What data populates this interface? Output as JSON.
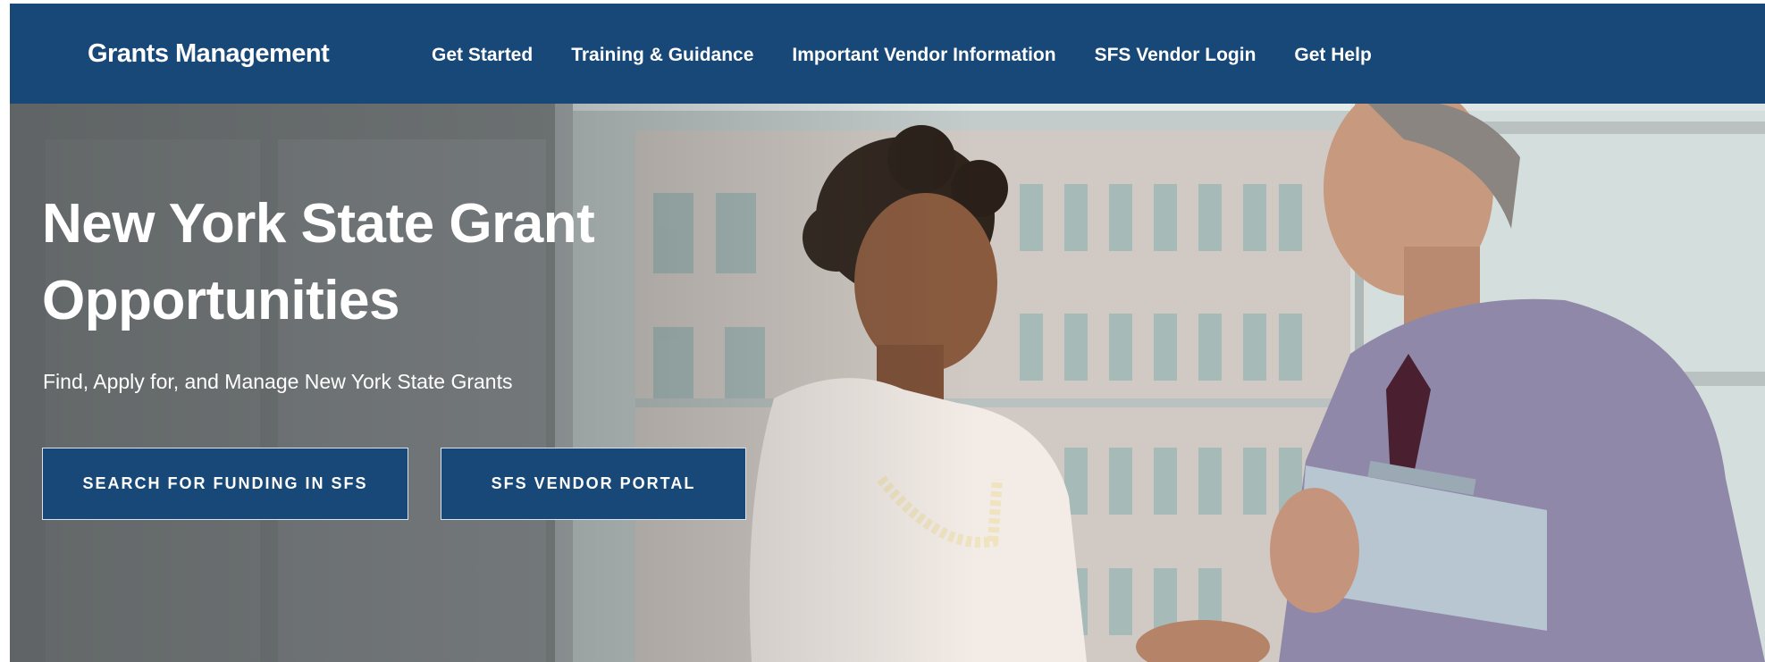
{
  "header": {
    "brand": "Grants Management",
    "nav": [
      {
        "label": "Get Started"
      },
      {
        "label": "Training & Guidance"
      },
      {
        "label": "Important Vendor Information"
      },
      {
        "label": "SFS Vendor Login"
      },
      {
        "label": "Get Help"
      }
    ]
  },
  "hero": {
    "title": "New York State Grant Opportunities",
    "subtitle": "Find, Apply for, and Manage New York State Grants",
    "buttons": {
      "search_label": "SEARCH FOR FUNDING IN SFS",
      "portal_label": "SFS VENDOR PORTAL"
    },
    "image": "hero-photo-two-people-handshake-office"
  },
  "colors": {
    "navbar": "#174878",
    "button": "#174878",
    "text": "#ffffff"
  }
}
